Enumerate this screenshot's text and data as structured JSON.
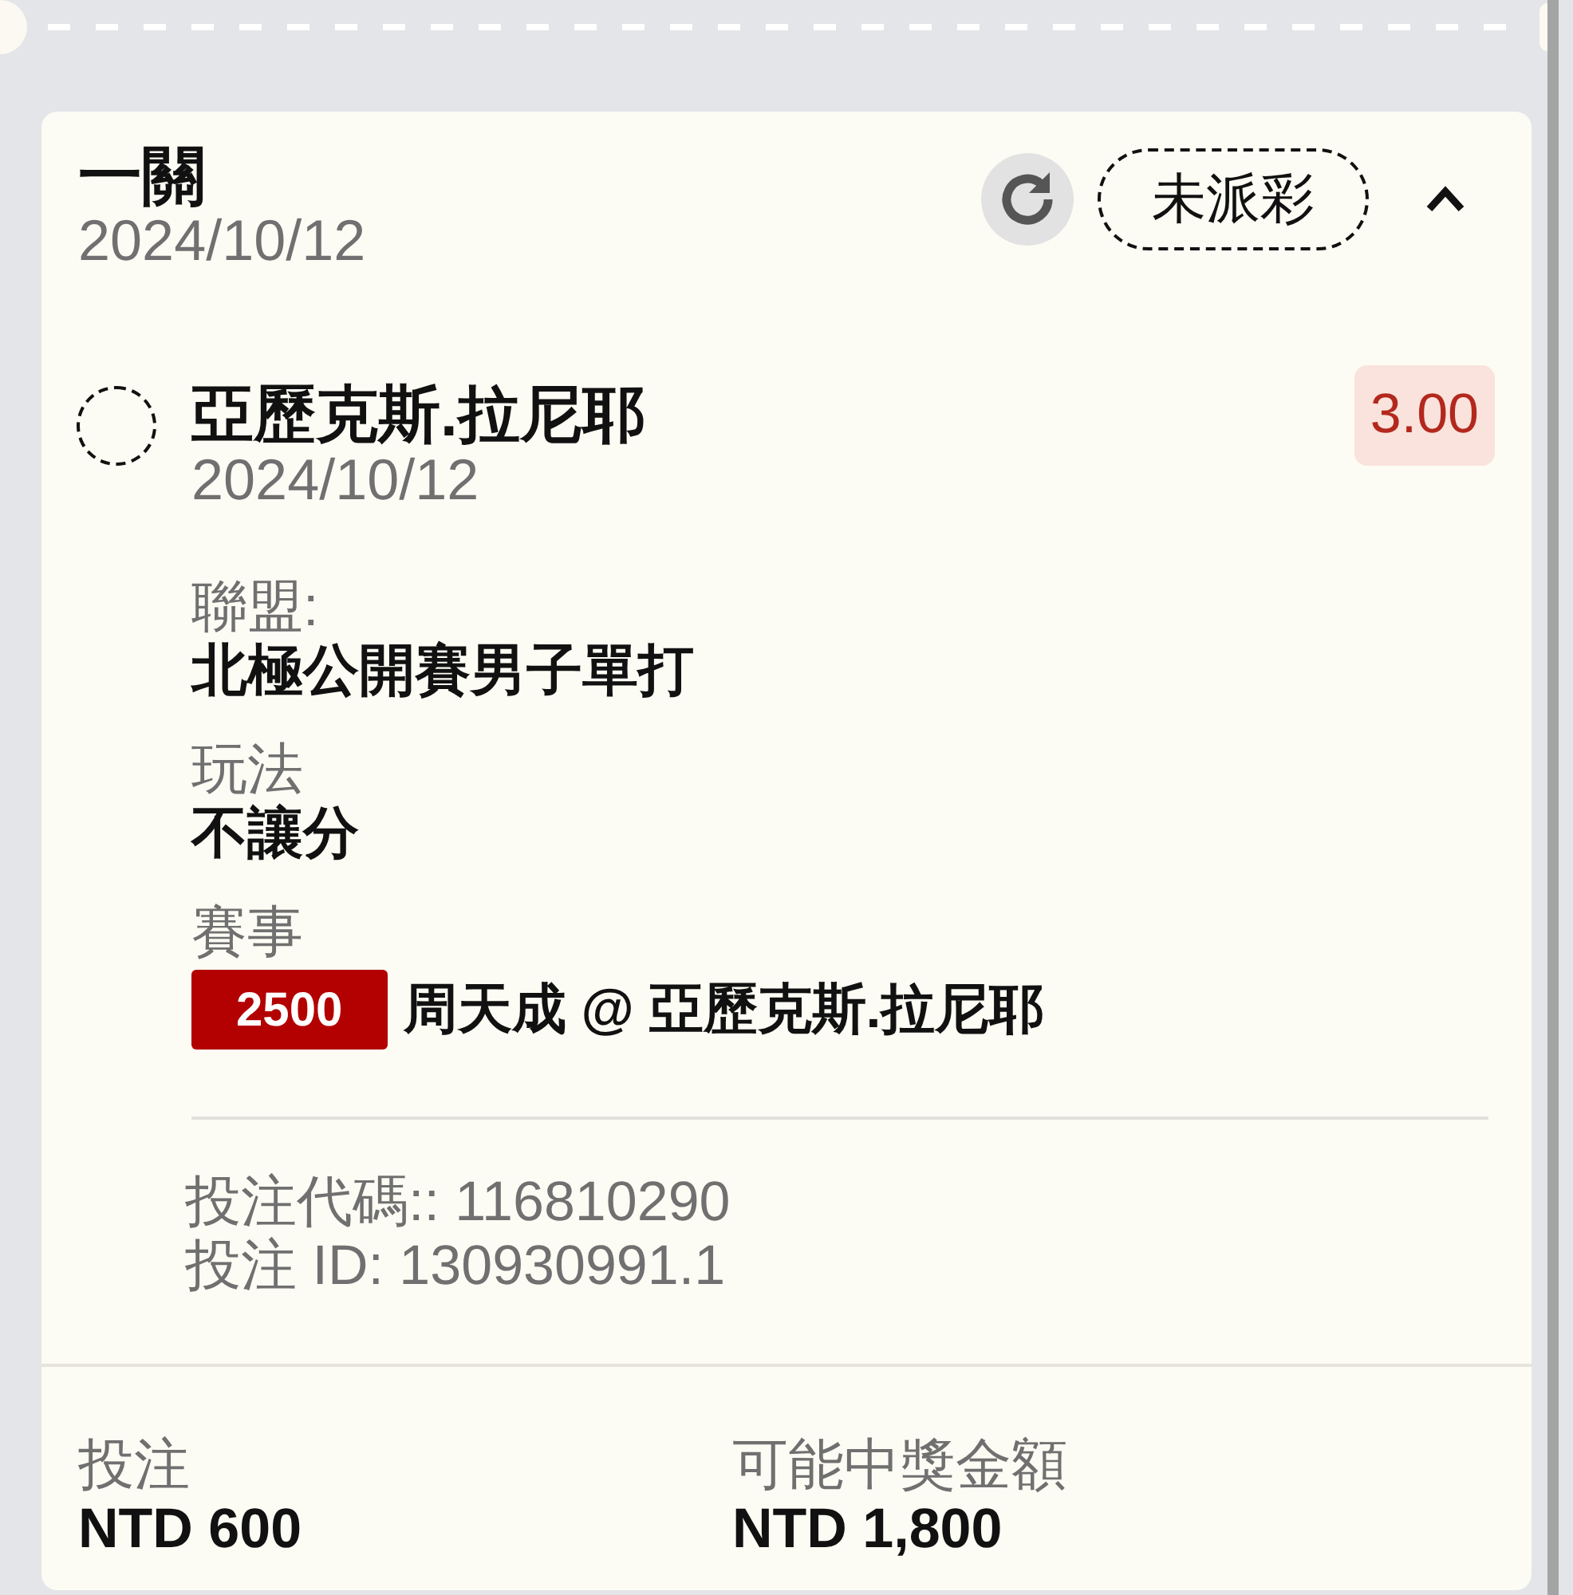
{
  "bet": {
    "title": "一關",
    "date": "2024/10/12",
    "status": "未派彩",
    "expanded": true
  },
  "legs": [
    {
      "selection": "亞歷克斯.拉尼耶",
      "date": "2024/10/12",
      "odds": "3.00",
      "details": [
        {
          "label": "聯盟:",
          "value": "北極公開賽男子單打"
        },
        {
          "label": "玩法",
          "value": "不讓分"
        },
        {
          "label": "賽事",
          "code": "2500",
          "value": "周天成 @ 亞歷克斯.拉尼耶"
        }
      ]
    }
  ],
  "references": [
    "投注代碼:: 116810290",
    "投注 ID: 130930991.1"
  ],
  "summary": [
    {
      "label": "投注",
      "value": "NTD 600"
    },
    {
      "label": "可能中獎金額",
      "value": "NTD 1,800"
    }
  ]
}
